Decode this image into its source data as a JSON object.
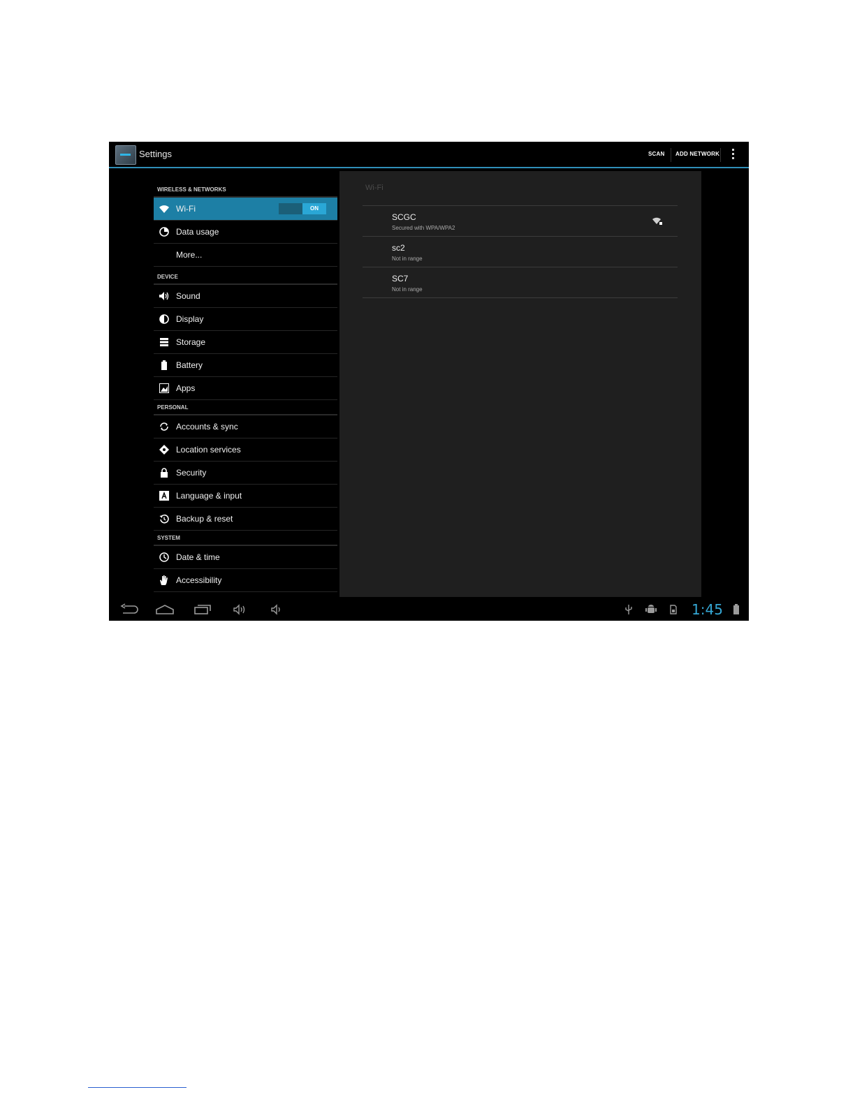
{
  "action_bar": {
    "title": "Settings",
    "scan_label": "SCAN",
    "add_network_label": "ADD NETWORK"
  },
  "sidebar": {
    "wireless_header": "WIRELESS & NETWORKS",
    "wifi_label": "Wi-Fi",
    "wifi_toggle_state": "ON",
    "data_usage_label": "Data usage",
    "more_label": "More...",
    "device_header": "DEVICE",
    "sound_label": "Sound",
    "display_label": "Display",
    "storage_label": "Storage",
    "battery_label": "Battery",
    "apps_label": "Apps",
    "personal_header": "PERSONAL",
    "accounts_label": "Accounts & sync",
    "location_label": "Location services",
    "security_label": "Security",
    "language_label": "Language & input",
    "backup_label": "Backup & reset",
    "system_header": "SYSTEM",
    "datetime_label": "Date & time",
    "accessibility_label": "Accessibility"
  },
  "wifi_panel": {
    "title": "Wi-Fi",
    "networks": [
      {
        "ssid": "SCGC",
        "status": "Secured with WPA/WPA2"
      },
      {
        "ssid": "sc2",
        "status": "Not in range"
      },
      {
        "ssid": "SC7",
        "status": "Not in range"
      }
    ]
  },
  "status_bar": {
    "clock": "1:45"
  },
  "colors": {
    "accent": "#2aa7d6",
    "selected_row": "#1d7fa5",
    "panel_bg": "#1f1f1f"
  }
}
